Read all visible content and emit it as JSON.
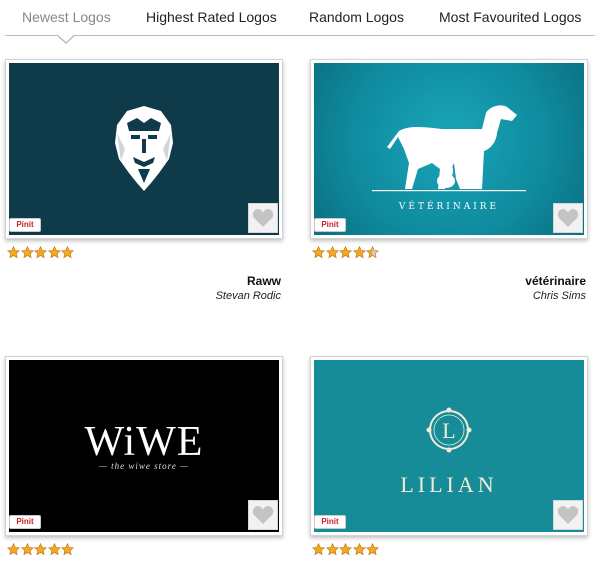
{
  "tabs": [
    {
      "label": "Newest Logos",
      "active": true
    },
    {
      "label": "Highest Rated Logos",
      "active": false
    },
    {
      "label": "Random Logos",
      "active": false
    },
    {
      "label": "Most Favourited Logos",
      "active": false
    }
  ],
  "pin_label": "Pinit",
  "colors": {
    "tab_active": "#888888",
    "star_fill": "#f5a623",
    "star_empty": "#cfcfcf",
    "pin_red": "#cb2027"
  },
  "logos": [
    {
      "title": "Raww",
      "author": "Stevan Rodic",
      "rating": 5,
      "bg": "#0e3a4a",
      "icon": "lion-face-icon",
      "art_text": ""
    },
    {
      "title": "vétérinaire",
      "author": "Chris Sims",
      "rating": 4.5,
      "bg": "#0f8a9e",
      "icon": "dog-cat-rabbit-icon",
      "art_text": "VÉTÉRINAIRE"
    },
    {
      "title": "",
      "author": "",
      "rating": 5,
      "bg": "#000000",
      "icon": "",
      "art_text": "WiWE",
      "art_tagline": "— the wiwe store —"
    },
    {
      "title": "",
      "author": "",
      "rating": 5,
      "bg": "#168c98",
      "icon": "monogram-l-icon",
      "art_text": "LILIAN",
      "art_letter": "L"
    }
  ]
}
